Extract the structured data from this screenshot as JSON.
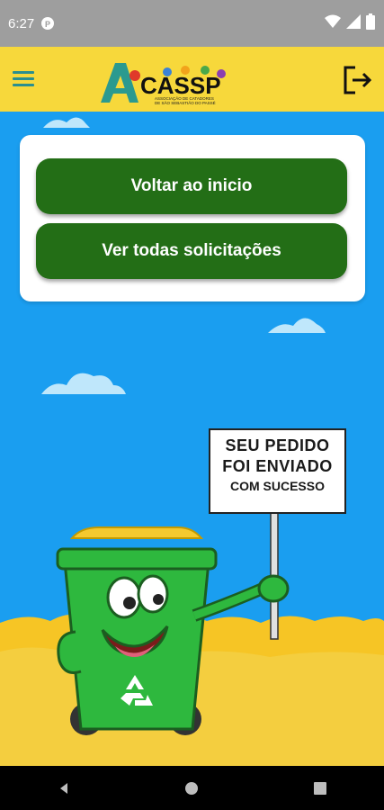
{
  "status_bar": {
    "time": "6:27",
    "icons": [
      "notification-p-icon",
      "wifi-icon",
      "signal-icon",
      "battery-icon"
    ]
  },
  "app_bar": {
    "logo_text": "CASSP",
    "logo_subtitle_1": "ASSOCIAÇÃO DE CATADORES",
    "logo_subtitle_2": "DE SÃO SEBASTIÃO DO PASSÉ",
    "menu_icon": "hamburger-menu-icon",
    "logout_icon": "logout-icon"
  },
  "card": {
    "button_home_label": "Voltar ao inicio",
    "button_all_label": "Ver todas solicitações"
  },
  "sign": {
    "line1": "SEU PEDIDO",
    "line2": "FOI ENVIADO",
    "line3": "COM SUCESSO"
  },
  "nav_bar": {
    "icons": [
      "back-icon",
      "home-icon",
      "recents-icon"
    ]
  },
  "colors": {
    "status_bar": "#9e9e9e",
    "app_bar": "#f7d83b",
    "sky": "#1a9ef0",
    "button": "#236e16",
    "sand": "#f6c525",
    "bin_green": "#2eb83e",
    "bin_lid": "#f5c92f"
  }
}
